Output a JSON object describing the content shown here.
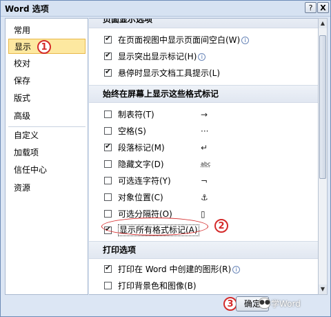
{
  "window": {
    "title": "Word 选项",
    "help_glyph": "?",
    "close_glyph": "X"
  },
  "sidebar": {
    "items": [
      {
        "label": "常用"
      },
      {
        "label": "显示",
        "selected": true
      },
      {
        "label": "校对"
      },
      {
        "label": "保存"
      },
      {
        "label": "版式"
      },
      {
        "label": "高级"
      },
      {
        "label": "自定义"
      },
      {
        "label": "加载项"
      },
      {
        "label": "信任中心"
      },
      {
        "label": "资源"
      }
    ]
  },
  "content": {
    "sections": [
      {
        "title": "页面显示选项"
      },
      {
        "title": "始终在屏幕上显示这些格式标记"
      },
      {
        "title": "打印选项"
      }
    ],
    "page_display": [
      {
        "label": "在页面视图中显示页面间空白(W)",
        "checked": true,
        "info": true
      },
      {
        "label": "显示突出显示标记(H)",
        "checked": true,
        "info": true
      },
      {
        "label": "悬停时显示文档工具提示(L)",
        "checked": true,
        "info": false
      }
    ],
    "format_marks": [
      {
        "label": "制表符(T)",
        "checked": false,
        "mark": "→"
      },
      {
        "label": "空格(S)",
        "checked": false,
        "mark": "···"
      },
      {
        "label": "段落标记(M)",
        "checked": true,
        "mark": "↵"
      },
      {
        "label": "隐藏文字(D)",
        "checked": false,
        "mark": "abc"
      },
      {
        "label": "可选连字符(Y)",
        "checked": false,
        "mark": "¬"
      },
      {
        "label": "对象位置(C)",
        "checked": false,
        "mark": "⚓"
      },
      {
        "label": "可选分隔符(O)",
        "checked": false,
        "mark": "▯"
      },
      {
        "label": "显示所有格式标记(A)",
        "checked": true,
        "mark": ""
      }
    ],
    "print_options": [
      {
        "label": "打印在 Word 中创建的图形(R)",
        "checked": true,
        "info": true
      },
      {
        "label": "打印背景色和图像(B)",
        "checked": false,
        "info": false
      }
    ]
  },
  "footer": {
    "ok_label": "确定"
  },
  "annotations": {
    "one": "1",
    "two": "2",
    "three": "3"
  },
  "watermark": {
    "text": "学Word"
  },
  "accent_color": "#d42a2a",
  "selected_color": "#fde8a0"
}
